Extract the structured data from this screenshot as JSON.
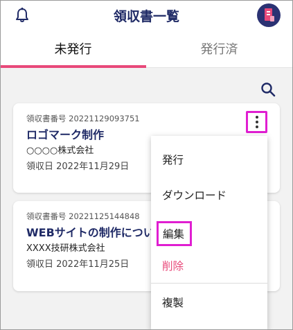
{
  "header": {
    "title": "領収書一覧"
  },
  "tabs": [
    {
      "label": "未発行",
      "active": true
    },
    {
      "label": "発行済",
      "active": false
    }
  ],
  "receipts": [
    {
      "number": "領収書番号 20221129093751",
      "title": "ロゴマーク制作",
      "company": "○○○○株式会社",
      "date": "領収日 2022年11月29日"
    },
    {
      "number": "領収書番号 20221125144848",
      "title": "WEBサイトの制作につい",
      "company": "XXXX技研株式会社",
      "date": "領収日 2022年11月25日"
    }
  ],
  "menu": {
    "items": [
      "発行",
      "ダウンロード",
      "編集",
      "削除",
      "複製"
    ]
  },
  "colors": {
    "accent": "#e8497a",
    "navy": "#1f2a66",
    "highlight": "#e01ed1"
  },
  "icons": [
    "bell-icon",
    "avatar-icon",
    "search-icon",
    "more-vert-icon"
  ]
}
